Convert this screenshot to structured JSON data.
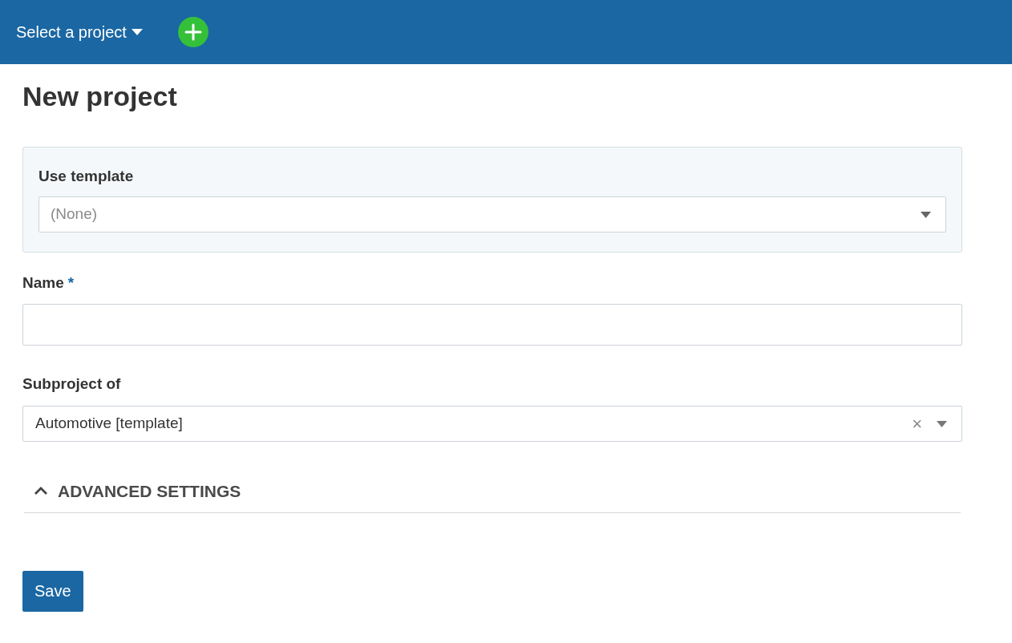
{
  "header": {
    "project_selector": "Select a project"
  },
  "page": {
    "title": "New project"
  },
  "template": {
    "label": "Use template",
    "placeholder": "(None)"
  },
  "name_field": {
    "label": "Name",
    "required_mark": "*"
  },
  "parent_field": {
    "label": "Subproject of",
    "value": "Automotive [template]",
    "clear": "×"
  },
  "advanced": {
    "label": "ADVANCED SETTINGS"
  },
  "buttons": [
    {
      "label": "Save"
    }
  ]
}
